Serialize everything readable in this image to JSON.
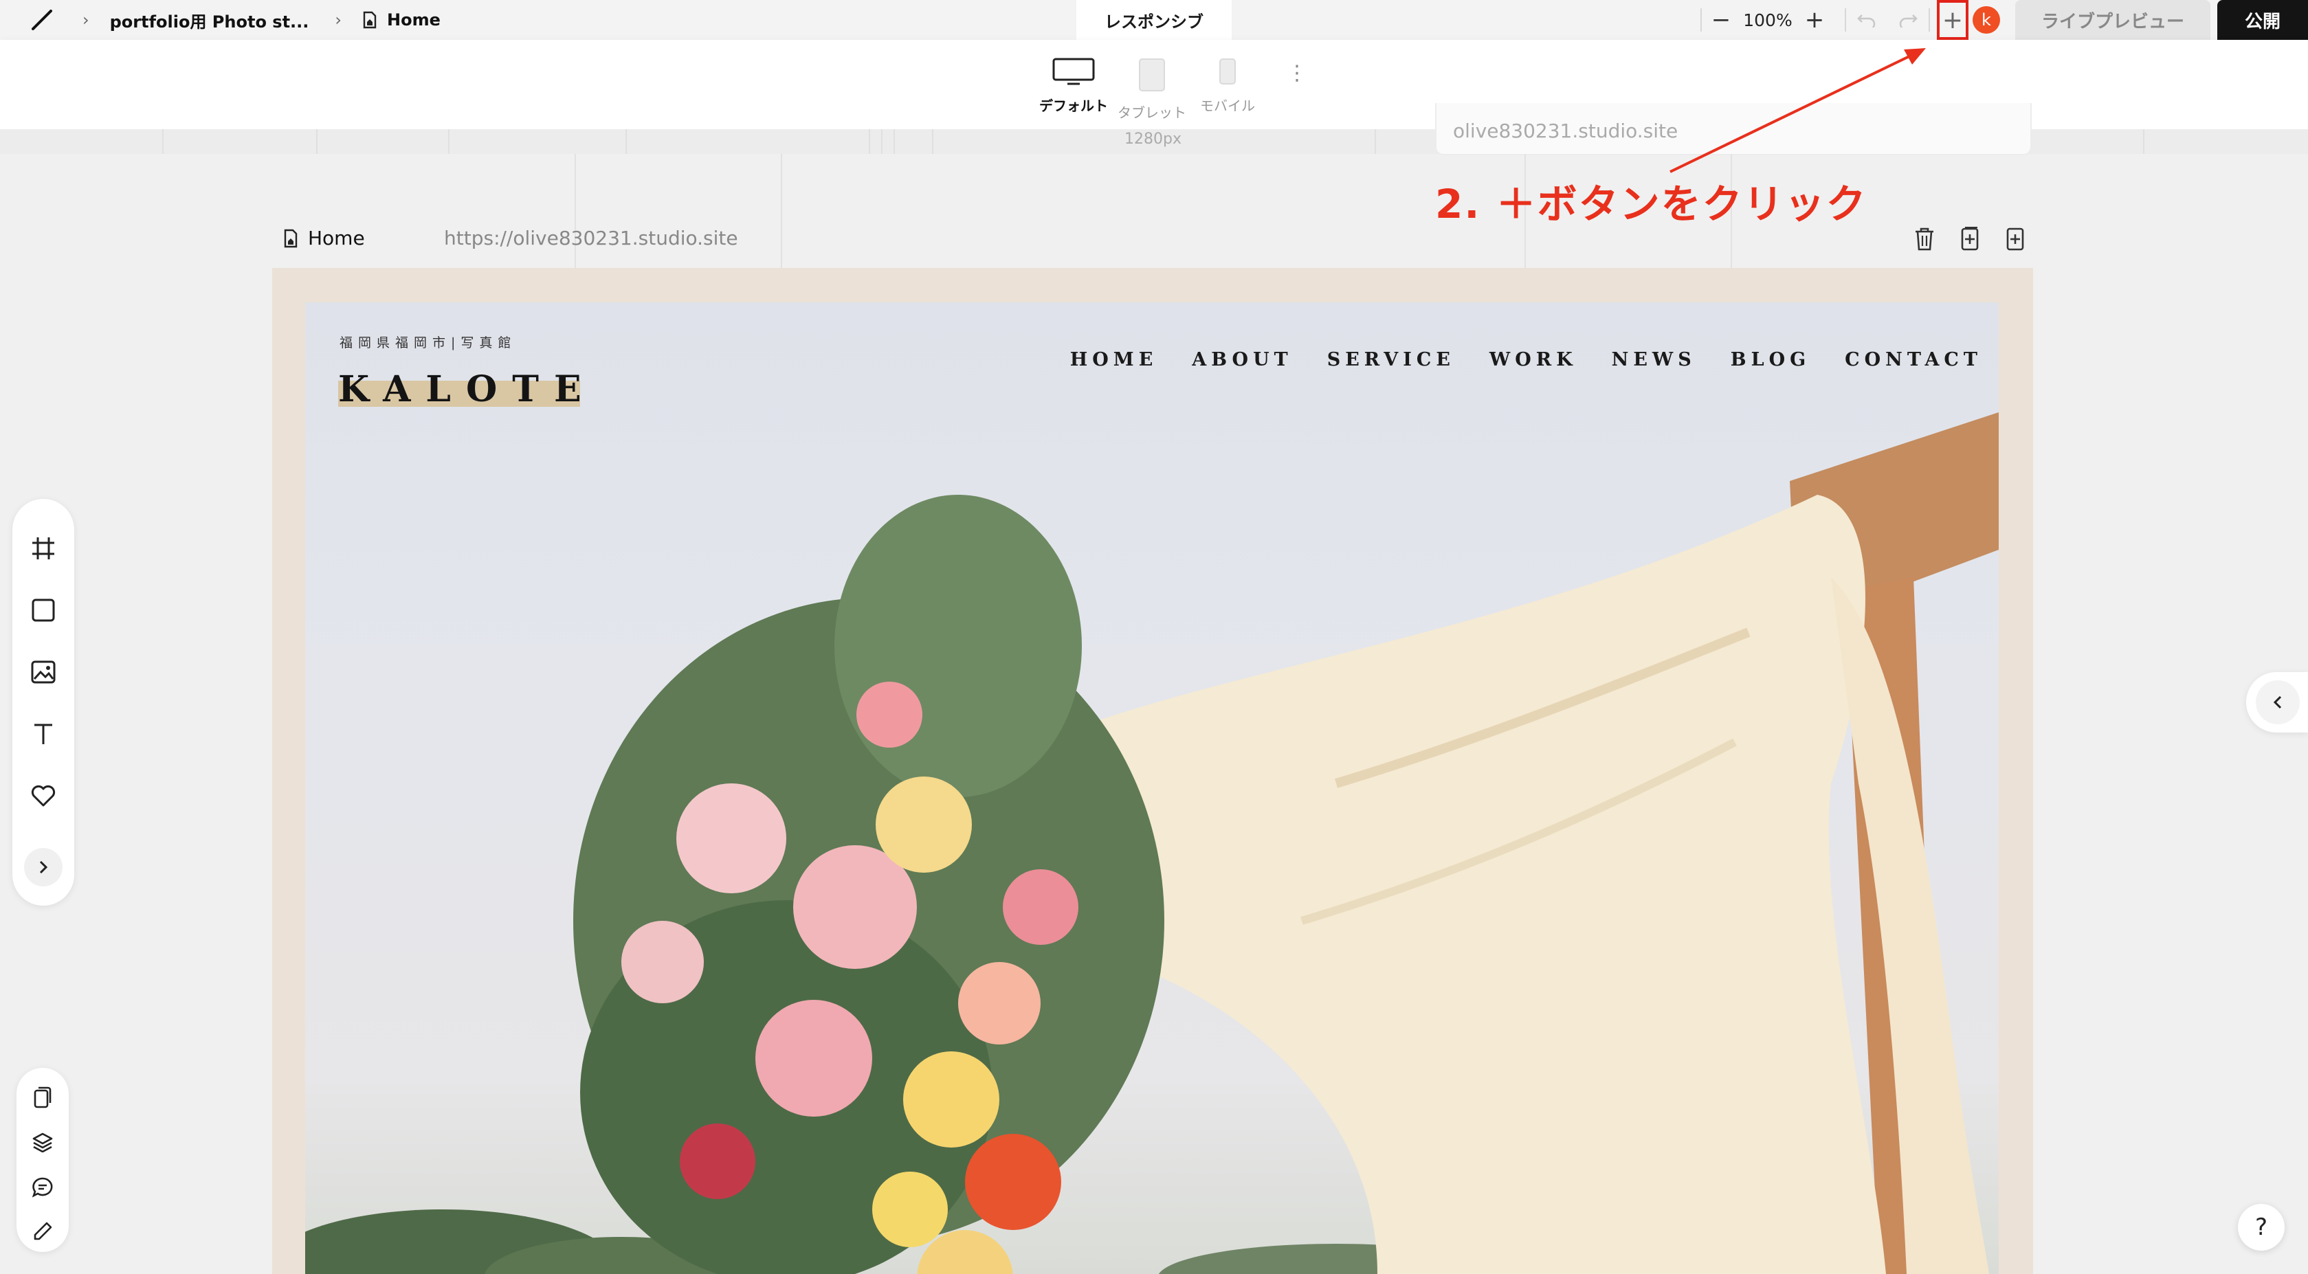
{
  "topbar": {
    "project_name": "portfolio用 Photo st...",
    "page_name": "Home",
    "mode_tab": "レスポンシブ",
    "zoom_minus": "−",
    "zoom_value": "100%",
    "zoom_plus": "+",
    "add_button": "+",
    "avatar_initial": "k",
    "live_preview": "ライブプレビュー",
    "publish": "公開"
  },
  "devices": {
    "default_label": "デフォルト",
    "tablet_label": "タブレット",
    "mobile_label": "モバイル",
    "more": "⋮"
  },
  "ruler": {
    "width_label": "1280px",
    "url_peek": "olive830231.studio.site"
  },
  "page": {
    "name": "Home",
    "url": "https://olive830231.studio.site"
  },
  "site": {
    "subtitle": "福岡県福岡市|写真館",
    "logo": "KALOTE",
    "nav": [
      "HOME",
      "ABOUT",
      "SERVICE",
      "WORK",
      "NEWS",
      "BLOG",
      "CONTACT"
    ]
  },
  "annotation": {
    "text": "2. ＋ボタンをクリック",
    "color": "#e8301c"
  },
  "help": "?",
  "colors": {
    "accent": "#e2231a",
    "avatar": "#f04e23",
    "frame_bg": "#ebe1d6",
    "logo_highlight": "#d9c6a3"
  },
  "icons": {
    "tools": [
      "frame-icon",
      "rectangle-icon",
      "image-icon",
      "text-icon",
      "heart-icon",
      "chevron-right-icon"
    ],
    "bottom_tools": [
      "pages-icon",
      "layers-icon",
      "comment-icon",
      "pen-icon"
    ],
    "page_actions": [
      "trash-icon",
      "duplicate-page-icon",
      "add-page-icon"
    ]
  }
}
